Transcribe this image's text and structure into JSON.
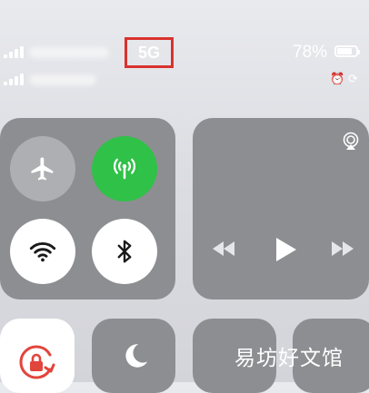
{
  "status_bar": {
    "network_type": "5G",
    "battery_percent": "78%",
    "battery_level": 0.78
  },
  "connectivity": {
    "airplane_mode": false,
    "cellular_data": true,
    "wifi": true,
    "bluetooth": true
  },
  "colors": {
    "accent_green": "#30c148",
    "highlight_red": "#d9322f"
  },
  "watermark": "易坊好文馆"
}
